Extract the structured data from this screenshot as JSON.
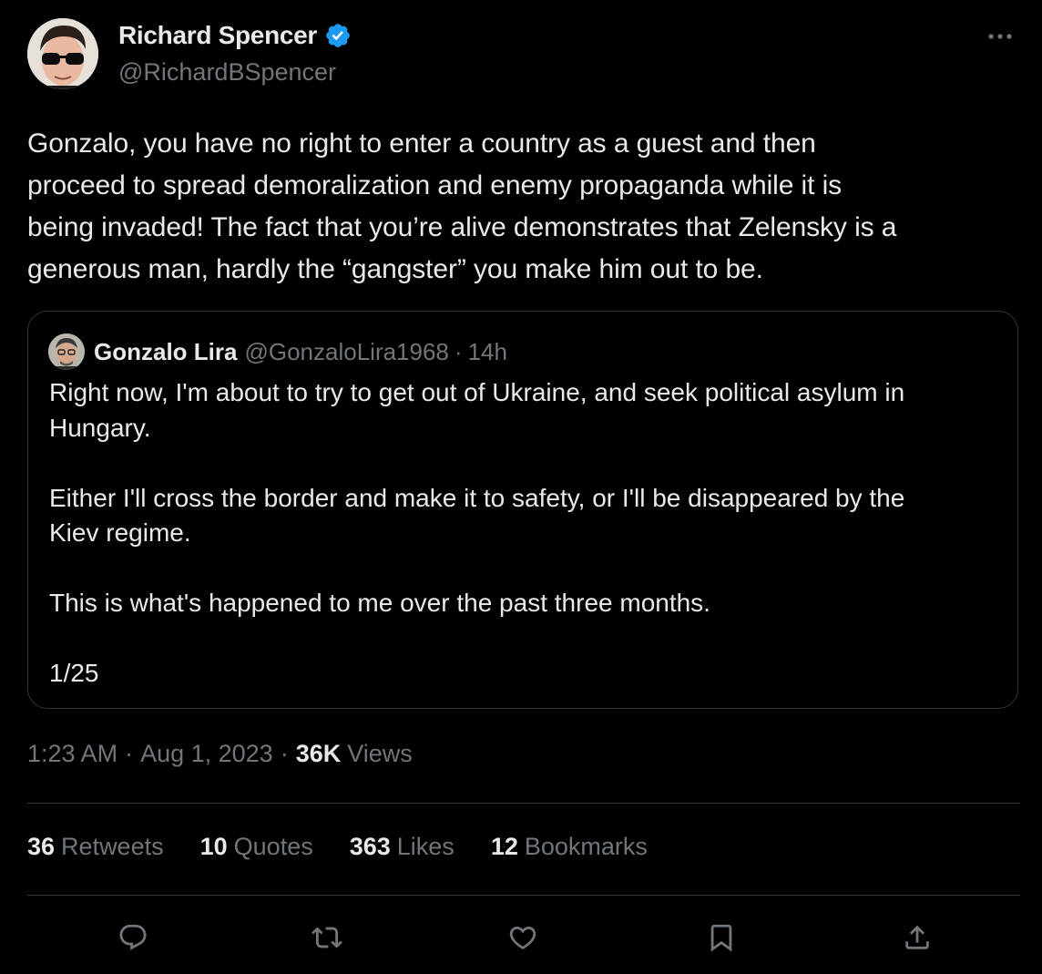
{
  "tweet": {
    "author": {
      "name": "Richard Spencer",
      "handle": "@RichardBSpencer",
      "verified": true
    },
    "text": "Gonzalo, you have no right to enter a country as a guest and then\nproceed to spread demoralization and enemy propaganda while it is\nbeing invaded! The fact that you’re alive demonstrates that Zelensky is a\ngenerous man, hardly the “gangster” you make him out to be.",
    "quote": {
      "name": "Gonzalo Lira",
      "handle": "@GonzaloLira1968",
      "separator": "·",
      "time": "14h",
      "text": "Right now, I'm about to try to get out of Ukraine, and seek political asylum in\nHungary.\n\nEither I'll cross the border and make it to safety, or I'll be disappeared by the\nKiev regime.\n\nThis is what's happened to me over the past three months.\n\n1/25"
    },
    "meta": {
      "time": "1:23 AM",
      "separator": "·",
      "date": "Aug 1, 2023",
      "views_count": "36K",
      "views_label": "Views"
    },
    "stats": {
      "retweets": {
        "count": "36",
        "label": "Retweets"
      },
      "quotes": {
        "count": "10",
        "label": "Quotes"
      },
      "likes": {
        "count": "363",
        "label": "Likes"
      },
      "bookmarks": {
        "count": "12",
        "label": "Bookmarks"
      }
    },
    "actions": [
      "reply-icon",
      "retweet-icon",
      "like-icon",
      "bookmark-icon",
      "share-icon"
    ]
  },
  "colors": {
    "background": "#000000",
    "primary_text": "#e7e9ea",
    "secondary_text": "#71767b",
    "border": "#333639",
    "verified_blue": "#1d9bf0"
  }
}
